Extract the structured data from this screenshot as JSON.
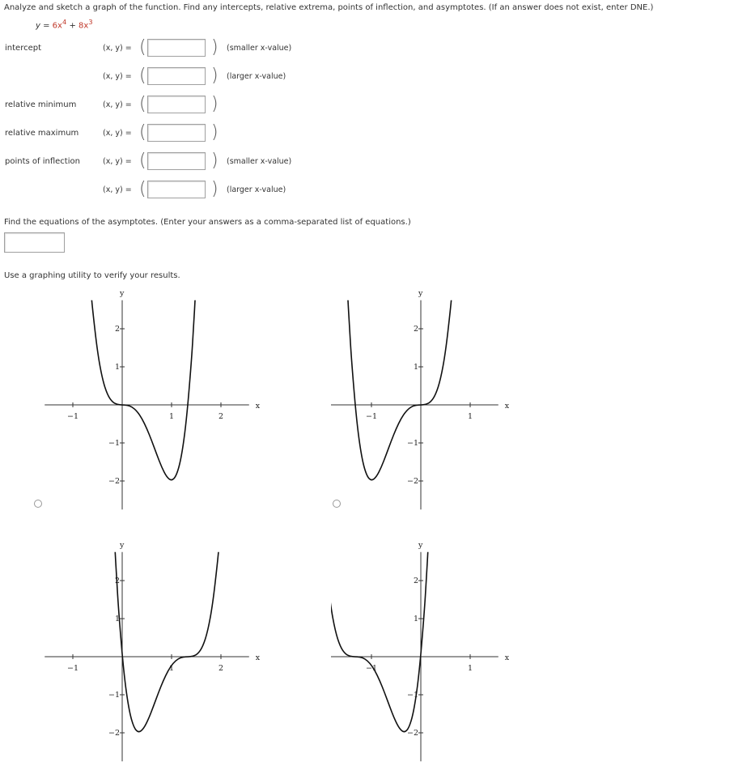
{
  "question": "Analyze and sketch a graph of the function. Find any intercepts, relative extrema, points of inflection, and asymptotes. (If an answer does not exist, enter DNE.)",
  "function": {
    "lhs": "y",
    "eq": " = ",
    "term1": "6x",
    "exp1": "4",
    "plus": " + ",
    "term2": "8x",
    "exp2": "3"
  },
  "rows": [
    {
      "label": "intercept",
      "xy": "(x, y) =",
      "note": "(smaller x-value)",
      "value": ""
    },
    {
      "label": "",
      "xy": "(x, y) =",
      "note": "(larger x-value)",
      "value": ""
    },
    {
      "label": "relative minimum",
      "xy": "(x, y) =",
      "note": "",
      "value": ""
    },
    {
      "label": "relative maximum",
      "xy": "(x, y) =",
      "note": "",
      "value": ""
    },
    {
      "label": "points of inflection",
      "xy": "(x, y) =",
      "note": "(smaller x-value)",
      "value": ""
    },
    {
      "label": "",
      "xy": "(x, y) =",
      "note": "(larger x-value)",
      "value": ""
    }
  ],
  "paren_open": "(",
  "paren_close": ")",
  "asymptote_prompt": "Find the equations of the asymptotes. (Enter your answers as a comma-separated list of equations.)",
  "asymptote_value": "",
  "graph_prompt": "Use a graphing utility to verify your results.",
  "chart_data": [
    {
      "type": "line",
      "xlabel": "x",
      "ylabel": "y",
      "xlim": [
        -1.57,
        2.57
      ],
      "ylim": [
        -2.75,
        2.75
      ],
      "xticks": [
        -1,
        1,
        2
      ],
      "yticks": [
        -2,
        -1,
        1,
        2
      ],
      "grid": false,
      "selected": false,
      "x": [
        -0.62,
        -0.6,
        -0.5,
        -0.4,
        -0.3,
        -0.2,
        -0.1,
        0,
        0.1,
        0.2,
        0.3,
        0.4,
        0.5,
        0.6,
        0.7,
        0.8,
        0.9,
        1.0,
        1.1,
        1.2,
        1.3,
        1.4,
        1.45,
        1.48
      ],
      "y": [
        2.793,
        2.506,
        1.375,
        0.666,
        0.265,
        0.074,
        0.009,
        0,
        -0.007,
        -0.054,
        -0.167,
        -0.358,
        -0.625,
        -0.95,
        -1.303,
        -1.638,
        -1.895,
        -2,
        -1.863,
        -1.382,
        -0.439,
        1.098,
        2.134,
        2.853
      ]
    },
    {
      "type": "line",
      "xlabel": "x",
      "ylabel": "y",
      "xlim": [
        -2.57,
        1.57
      ],
      "ylim": [
        -2.75,
        2.75
      ],
      "xticks": [
        -2,
        -1,
        1
      ],
      "yticks": [
        -2,
        -1,
        1,
        2
      ],
      "grid": false,
      "selected": false,
      "x": [
        0.62,
        0.6,
        0.5,
        0.4,
        0.3,
        0.2,
        0.1,
        0,
        -0.1,
        -0.2,
        -0.3,
        -0.4,
        -0.5,
        -0.6,
        -0.7,
        -0.8,
        -0.9,
        -1.0,
        -1.1,
        -1.2,
        -1.3,
        -1.4,
        -1.45,
        -1.48
      ],
      "y": [
        2.793,
        2.506,
        1.375,
        0.666,
        0.265,
        0.074,
        0.009,
        0,
        -0.007,
        -0.054,
        -0.167,
        -0.358,
        -0.625,
        -0.95,
        -1.303,
        -1.638,
        -1.895,
        -2,
        -1.863,
        -1.382,
        -0.439,
        1.098,
        2.134,
        2.853
      ]
    },
    {
      "type": "line",
      "xlabel": "x",
      "ylabel": "y",
      "xlim": [
        -1.57,
        2.57
      ],
      "ylim": [
        -2.75,
        2.75
      ],
      "xticks": [
        -1,
        1,
        2
      ],
      "yticks": [
        -2,
        -1,
        1,
        2
      ],
      "grid": false,
      "x": [
        1.953,
        1.933,
        1.833,
        1.733,
        1.633,
        1.533,
        1.433,
        1.333,
        1.233,
        1.133,
        1.033,
        0.933,
        0.833,
        0.733,
        0.633,
        0.533,
        0.433,
        0.333,
        0.233,
        0.133,
        0.033,
        -0.067,
        -0.117,
        -0.147
      ],
      "y": [
        2.793,
        2.506,
        1.375,
        0.666,
        0.265,
        0.074,
        0.009,
        0,
        -0.007,
        -0.054,
        -0.167,
        -0.358,
        -0.625,
        -0.95,
        -1.303,
        -1.638,
        -1.895,
        -2,
        -1.863,
        -1.382,
        -0.439,
        1.098,
        2.134,
        2.853
      ]
    },
    {
      "type": "line",
      "xlabel": "x",
      "ylabel": "y",
      "xlim": [
        -2.57,
        1.57
      ],
      "ylim": [
        -2.75,
        2.75
      ],
      "xticks": [
        -2,
        -1,
        1
      ],
      "yticks": [
        -2,
        -1,
        1,
        2
      ],
      "grid": false,
      "x": [
        -1.953,
        -1.933,
        -1.833,
        -1.733,
        -1.633,
        -1.533,
        -1.433,
        -1.333,
        -1.233,
        -1.133,
        -1.033,
        -0.933,
        -0.833,
        -0.733,
        -0.633,
        -0.533,
        -0.433,
        -0.333,
        -0.233,
        -0.133,
        -0.033,
        0.067,
        0.117,
        0.147
      ],
      "y": [
        2.793,
        2.506,
        1.375,
        0.666,
        0.265,
        0.074,
        0.009,
        0,
        -0.007,
        -0.054,
        -0.167,
        -0.358,
        -0.625,
        -0.95,
        -1.303,
        -1.638,
        -1.895,
        -2,
        -1.863,
        -1.382,
        -0.439,
        1.098,
        2.134,
        2.853
      ]
    }
  ]
}
